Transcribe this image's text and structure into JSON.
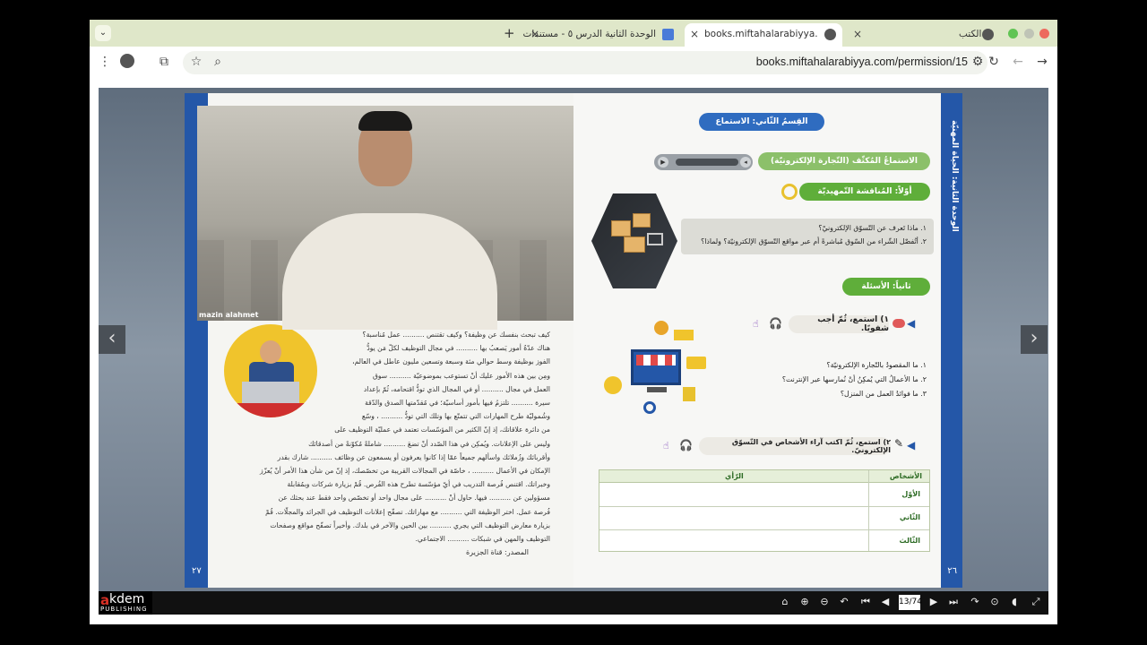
{
  "browser": {
    "tabs": [
      {
        "title": "الكتب",
        "active": false
      },
      {
        "title": "books.miftahalarabiyya.com/p",
        "active": true
      },
      {
        "title": "الوحدة الثانية الدرس ٥ - مستندات",
        "active": false
      }
    ],
    "url": "books.miftahalarabiyya.com/permission/15",
    "new_tab": "+",
    "close": "×",
    "dropdown": "⌄",
    "accent": "#dfe7c9"
  },
  "viewer": {
    "page_indicator": "13/74",
    "prev_arrow": "‹",
    "next_arrow": "›",
    "logo_main": "kdem",
    "logo_a": "a",
    "logo_sub": "PUBLISHING"
  },
  "video": {
    "name": "mazin alahmet"
  },
  "left_page": {
    "page_number": "٢٧",
    "paragraph_lines": [
      "كيف تبحث بنفسك عن وظيفة؟ وكيف تقتنص .......... عمل مُناسبة؟",
      "هناك عدّةُ أمور يَصعبُ بها .......... في مجال التوظيف لكلّ مَن يودُّ",
      "الفوز بوظيفة وسط حوالي مئة وسبعة وتسعين مليون عاطل في العالم،",
      "ومِن بين هذه الأمور عليك أنْ تستوعب بموضوعيّة .......... سوق",
      "العمل في مجال .......... أو في المجال الذي تودُّ اقتحامه، ثُمّ بإعداد",
      "سيرة .......... تلتزمُ فيها بأمور أساسيّة؛ في مُقدّمتها الصدق والدّقة",
      "وشُموليّة طرح المهارات التي تتمتّع بها وتلك التي تودُّ .......... ، وسّع",
      "من دائرة علاقاتك، إذ إنّ الكثير من المؤسّسات تعتمد في عمليّة التوظيف على",
      "وليس على الإعلانات. ويُمكِن في هذا الصّدد أنْ تضعَ .......... شاملةً مُكوّنةً من أصدقائك",
      "وأقربائك وزُملائك واسألهم جميعاً عمّا إذا كانوا يعرفون أو يسمعون عن وظائف .......... شارك بقدر",
      "الإمكان في الأعمال .......... ، خاصّة في المجالات القريبة من تخصّصك، إذ إنّ من شأن هذا الأمر أنْ يُعزّز",
      "وخبراتك. اقتنص فُرصة التدريب في أيّ مؤسّسة تطرح هذه الفُرص. قُمْ بزيارة شركات وبمُقابلة",
      "مسؤولين عن .......... فيها. حاول أنْ .......... على مجال واحد أو تخصّص واحد فقط عند بحثك عن",
      "فُرصة عمل. اختر الوظيفة التي .......... مع مهاراتك. تصفّح إعلانات التوظيف في الجرائد والمجلّات. قُمْ",
      "بزيارة معارض التوظيف التي يجري .......... بين الحين والآخر في بلدك. وأخيراً تصفّح مواقع وصفحات",
      "التوظيف والمهن في شبكات .......... الاجتماعي."
    ],
    "source": "المصدر: قناة الجزيرة"
  },
  "right_page": {
    "page_number": "٢٦",
    "unit_title": "الوحدة الثانية: الحياة المهنيّة",
    "section_title": "القِسمُ الثّاني: الاستماع",
    "listening_title": "الاستماعُ المُكثّف (التّجارة الإلكترونيّة)",
    "first_heading": "أوّلاً: المُناقشة التّمهيديّة",
    "intro_questions": [
      "١. ماذا تَعرف عن التّسوّق الإلكترونيّ؟",
      "٢. أتُفضّل الشّراء من السّوق مُباشرةً أم عبر مواقع التّسوّق الإلكترونيّة؟ ولماذا؟"
    ],
    "second_heading": "ثانياً: الأسئلة",
    "task1": "١) استمع، ثُمّ أجب شفويًا.",
    "task1_questions": [
      "١. ما المقصودُ بالتّجارة الإلكترونيّة؟",
      "٢. ما الأعمالُ التي يُمكِنُ أنْ نُمارسها عبر الإنترنت؟",
      "٣. ما فوائدُ العمل من المنزل؟"
    ],
    "task2": "٢) استمع، ثُمّ اكتب آراء الأشخاص في التّسوّق الإلكترونيّ.",
    "table": {
      "col_persons": "الأشخاص",
      "col_opinion": "الرّأي",
      "rows": [
        "الأوّل",
        "الثّاني",
        "الثّالث"
      ]
    }
  }
}
